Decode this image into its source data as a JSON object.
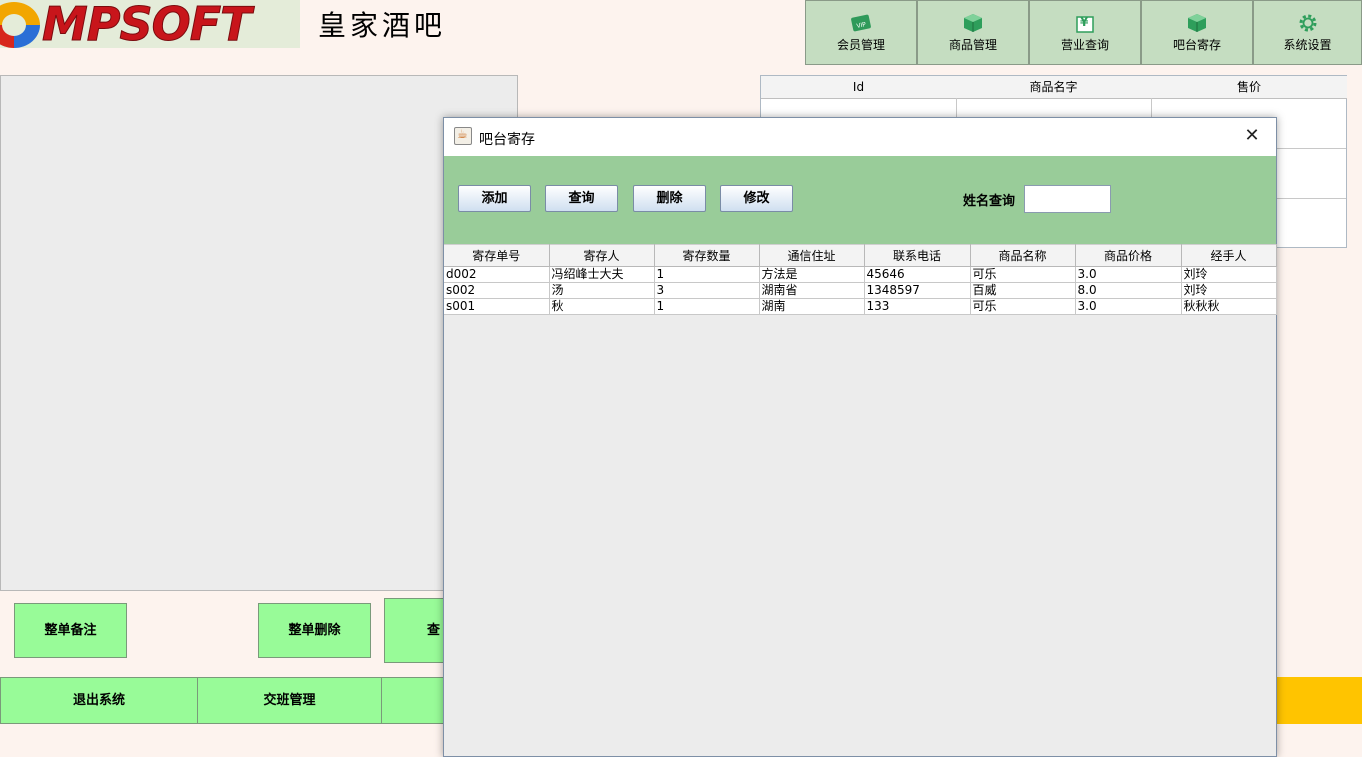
{
  "brand": {
    "logo_text": "MPSOFT",
    "app_title": "皇家酒吧"
  },
  "top_nav": [
    {
      "label": "会员管理",
      "icon": "vip-card-icon"
    },
    {
      "label": "商品管理",
      "icon": "box-icon"
    },
    {
      "label": "营业查询",
      "icon": "yen-icon"
    },
    {
      "label": "吧台寄存",
      "icon": "box-icon"
    },
    {
      "label": "系统设置",
      "icon": "gear-icon"
    }
  ],
  "bg_table": {
    "columns": [
      "Id",
      "商品名字",
      "售价"
    ]
  },
  "bg_buttons": {
    "note": "整单备注",
    "delete": "整单删除",
    "query_partial": "查",
    "exit": "退出系统",
    "shift": "交班管理"
  },
  "dialog": {
    "title": "吧台寄存",
    "buttons": [
      "添加",
      "查询",
      "删除",
      "修改"
    ],
    "search_label": "姓名查询",
    "search_value": "",
    "table": {
      "columns": [
        "寄存单号",
        "寄存人",
        "寄存数量",
        "通信住址",
        "联系电话",
        "商品名称",
        "商品价格",
        "经手人"
      ],
      "rows": [
        [
          "d002",
          "冯绍峰士大夫",
          "1",
          "方法是",
          "45646",
          "可乐",
          "3.0",
          "刘玲"
        ],
        [
          "s002",
          "汤",
          "3",
          "湖南省",
          "1348597",
          "百威",
          "8.0",
          "刘玲"
        ],
        [
          "s001",
          "秋",
          "1",
          "湖南",
          "133",
          "可乐",
          "3.0",
          "秋秋秋"
        ]
      ]
    }
  },
  "colors": {
    "background": "#fdf3ee",
    "green_button": "#98fb98",
    "toolbar_green": "#99cc99",
    "nav_green": "#c5ddc1",
    "accent_orange": "#ffc400"
  }
}
